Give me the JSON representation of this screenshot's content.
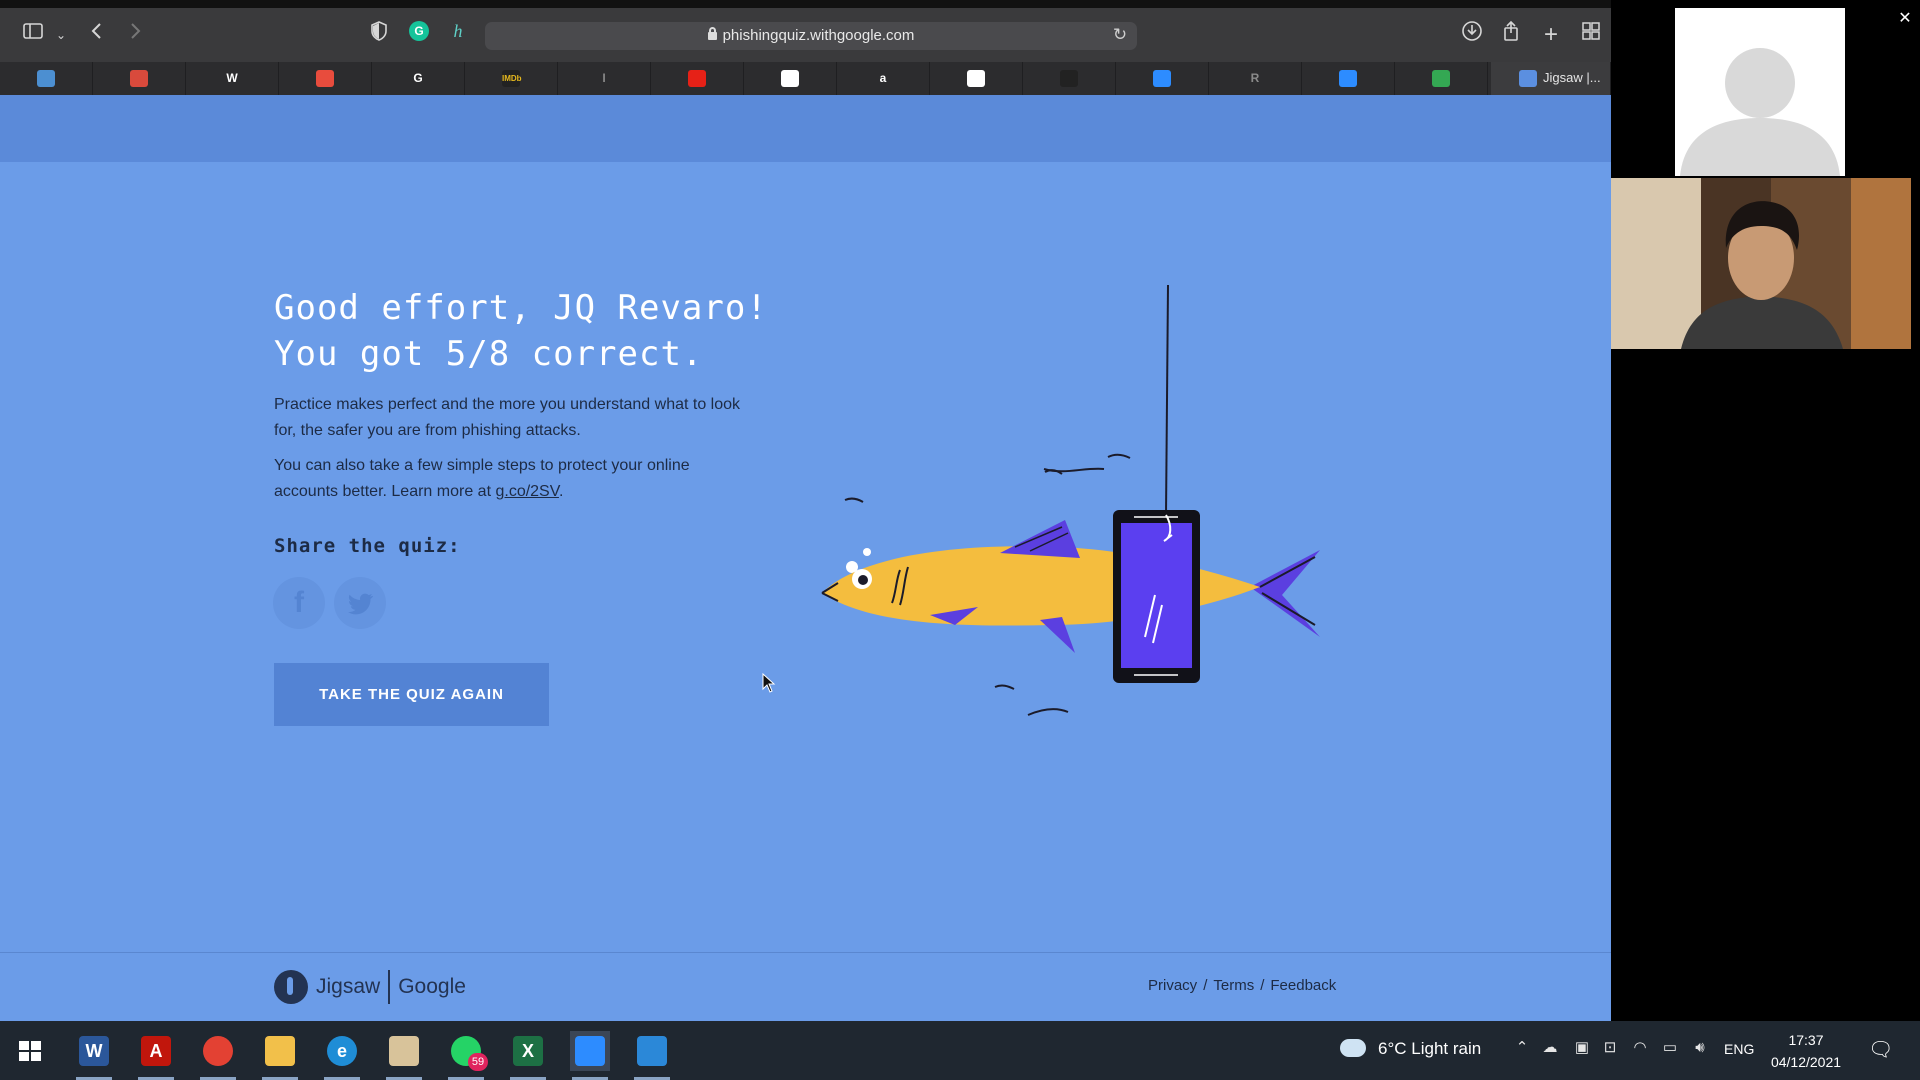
{
  "browser": {
    "url": "phishingquiz.withgoogle.com",
    "tabs": [
      {
        "icon": "wordpress-icon",
        "color": "#4c8fd1"
      },
      {
        "icon": "car-icon",
        "color": "#d94a3c"
      },
      {
        "icon": "wikipedia-icon",
        "glyph": "W",
        "color": "#ffffff"
      },
      {
        "icon": "asana-icon",
        "color": "#e84c3d"
      },
      {
        "icon": "google-icon",
        "glyph": "G",
        "color": "#ffffff"
      },
      {
        "icon": "imdb-icon",
        "glyph": "IMDb",
        "color": "#e6b91e"
      },
      {
        "icon": "generic-doc-icon",
        "glyph": "I",
        "color": "#888888"
      },
      {
        "icon": "youtube-icon",
        "color": "#e62117"
      },
      {
        "icon": "generic-page-icon",
        "color": "#ffffff"
      },
      {
        "icon": "amazon-icon",
        "glyph": "a",
        "color": "#ffffff"
      },
      {
        "icon": "monitor-icon",
        "color": "#ffffff"
      },
      {
        "icon": "dark-tab-icon",
        "color": "#222222"
      },
      {
        "icon": "zoom-icon",
        "color": "#2d8cff"
      },
      {
        "icon": "r-letter-icon",
        "glyph": "R",
        "color": "#8a8a8a"
      },
      {
        "icon": "zoom-icon",
        "color": "#2d8cff"
      },
      {
        "icon": "green-circle-icon",
        "color": "#34a853"
      }
    ],
    "active_tab": "Jigsaw |..."
  },
  "page": {
    "headline_line1": "Good effort, JQ Revaro!",
    "headline_line2": "You got 5/8 correct.",
    "para1": "Practice makes perfect and the more you understand what to look for, the safer you are from phishing attacks.",
    "para2_prefix": "You can also take a few simple steps to protect your online accounts better. Learn more at ",
    "para2_link": "g.co/2SV",
    "para2_suffix": ".",
    "share_label": "Share the quiz:",
    "facebook_glyph": "f",
    "twitter_glyph": "t",
    "quiz_again_label": "TAKE THE QUIZ AGAIN",
    "footer": {
      "jigsaw": "Jigsaw",
      "google": "Google",
      "privacy": "Privacy",
      "terms": "Terms",
      "feedback": "Feedback",
      "slash": "/"
    }
  },
  "taskbar": {
    "apps": [
      {
        "name": "word-icon",
        "glyph": "W",
        "color": "#2b579a"
      },
      {
        "name": "acrobat-icon",
        "glyph": "A",
        "color": "#c1160c"
      },
      {
        "name": "chrome-icon",
        "glyph": "",
        "color": "#e34133"
      },
      {
        "name": "file-explorer-icon",
        "glyph": "",
        "color": "#f2c04a"
      },
      {
        "name": "edge-icon",
        "glyph": "e",
        "color": "#1f8dd6"
      },
      {
        "name": "paint-icon",
        "glyph": "",
        "color": "#d8c39a"
      },
      {
        "name": "whatsapp-icon",
        "glyph": "",
        "color": "#25d366"
      },
      {
        "name": "excel-icon",
        "glyph": "X",
        "color": "#1d7044"
      },
      {
        "name": "zoom-app-icon",
        "glyph": "",
        "color": "#2d8cff"
      },
      {
        "name": "photos-icon",
        "glyph": "",
        "color": "#2b88d8"
      }
    ],
    "whatsapp_badge": "59",
    "weather": "6°C  Light rain",
    "language": "ENG",
    "time": "17:37",
    "date": "04/12/2021"
  },
  "colors": {
    "page_bg": "#6b9ce8",
    "fish_yellow": "#f4bd3e",
    "fin_purple": "#5b3fe0",
    "phone_screen": "#5b3ff0"
  }
}
